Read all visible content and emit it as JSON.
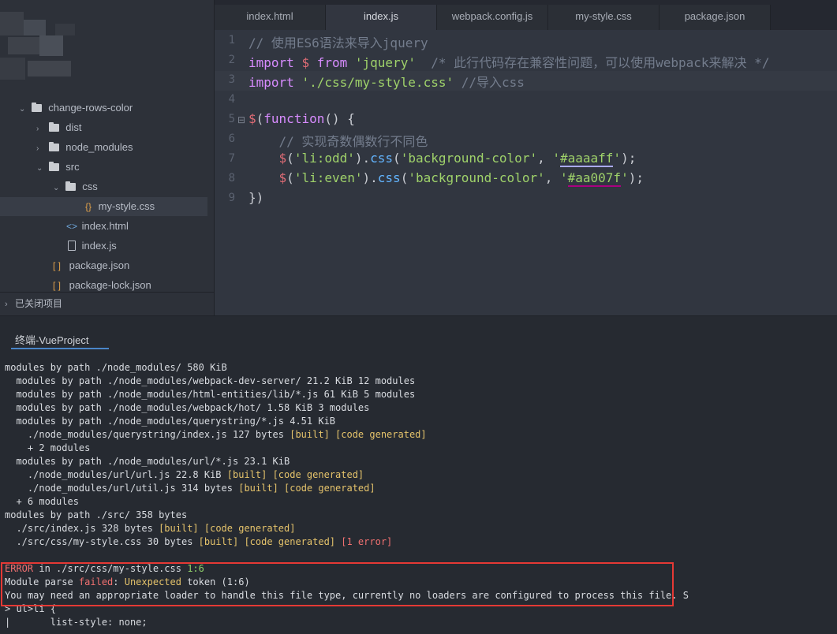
{
  "sidebar": {
    "tree": [
      {
        "label": "change-rows-color",
        "type": "folder",
        "expanded": true
      },
      {
        "label": "dist",
        "type": "folder",
        "expanded": false
      },
      {
        "label": "node_modules",
        "type": "folder",
        "expanded": false
      },
      {
        "label": "src",
        "type": "folder",
        "expanded": true
      },
      {
        "label": "css",
        "type": "folder",
        "expanded": true
      },
      {
        "label": "my-style.css",
        "type": "css-file",
        "icon": "{}"
      },
      {
        "label": "index.html",
        "type": "html-file",
        "icon": "<>"
      },
      {
        "label": "index.js",
        "type": "js-file"
      },
      {
        "label": "package.json",
        "type": "json-file",
        "icon": "[ ]"
      },
      {
        "label": "package-lock.json",
        "type": "json-file",
        "icon": "[ ]"
      }
    ],
    "closed_projects": "已关闭项目"
  },
  "tabs": [
    {
      "label": "index.html",
      "active": false
    },
    {
      "label": "index.js",
      "active": true
    },
    {
      "label": "webpack.config.js",
      "active": false
    },
    {
      "label": "my-style.css",
      "active": false
    },
    {
      "label": "package.json",
      "active": false
    }
  ],
  "editor": {
    "line_numbers": [
      "1",
      "2",
      "3",
      "4",
      "5",
      "6",
      "7",
      "8",
      "9"
    ],
    "lines": {
      "l1": "// 使用ES6语法来导入jquery",
      "l2": {
        "kw1": "import",
        "dollar": "$",
        "kw2": "from",
        "str": "'jquery'",
        "comment": "/* 此行代码存在兼容性问题，可以使用webpack来解决 */"
      },
      "l3": {
        "kw": "import",
        "str": "'./css/my-style.css'",
        "comment": "//导入css"
      },
      "l5": {
        "dollar": "$",
        "open": "(",
        "kw": "function",
        "rest": "() {"
      },
      "l6": "// 实现奇数偶数行不同色",
      "l7": {
        "dollar": "$",
        "p1": "(",
        "sel": "'li:odd'",
        "p2": ").",
        "method": "css",
        "p3": "(",
        "prop": "'background-color'",
        "comma": ", ",
        "q1": "'",
        "val": "#aaaaff",
        "q2": "'",
        "end": ");"
      },
      "l8": {
        "dollar": "$",
        "p1": "(",
        "sel": "'li:even'",
        "p2": ").",
        "method": "css",
        "p3": "(",
        "prop": "'background-color'",
        "comma": ", ",
        "q1": "'",
        "val": "#aa007f",
        "q2": "'",
        "end": ");"
      },
      "l9": "})"
    }
  },
  "terminal": {
    "tab": "终端-VueProject",
    "lines": [
      {
        "text": "modules by path ./node_modules/ 580 KiB"
      },
      {
        "text": "  modules by path ./node_modules/webpack-dev-server/ 21.2 KiB 12 modules"
      },
      {
        "text": "  modules by path ./node_modules/html-entities/lib/*.js 61 KiB 5 modules"
      },
      {
        "text": "  modules by path ./node_modules/webpack/hot/ 1.58 KiB 3 modules"
      },
      {
        "text": "  modules by path ./node_modules/querystring/*.js 4.51 KiB"
      },
      {
        "text": "    ./node_modules/querystring/index.js 127 bytes ",
        "tag": "[built] [code generated]"
      },
      {
        "text": "    + 2 modules"
      },
      {
        "text": "  modules by path ./node_modules/url/*.js 23.1 KiB"
      },
      {
        "text": "    ./node_modules/url/url.js 22.8 KiB ",
        "tag": "[built] [code generated]"
      },
      {
        "text": "    ./node_modules/url/util.js 314 bytes ",
        "tag": "[built] [code generated]"
      },
      {
        "text": "  + 6 modules"
      },
      {
        "text": "modules by path ./src/ 358 bytes"
      },
      {
        "text": "  ./src/index.js 328 bytes ",
        "tag": "[built] [code generated]"
      },
      {
        "text": "  ./src/css/my-style.css 30 bytes ",
        "tag": "[built] [code generated]",
        "err": " [1 error]"
      },
      {
        "text": ""
      }
    ],
    "error": {
      "label": "ERROR",
      "path": " in ./src/css/my-style.css ",
      "pos": "1:6",
      "line2_a": "Module parse ",
      "line2_b": "failed",
      "line2_c": ": ",
      "line2_d": "Unexpected",
      "line2_e": " token (1:6)",
      "line3": "You may need an appropriate loader to handle this file type, currently no loaders are configured to process this file. S"
    },
    "tail": [
      "> ul>li {",
      "|       list-style: none;"
    ]
  },
  "colors": {
    "accent": "#4a86c8",
    "error_box": "#e53935"
  }
}
